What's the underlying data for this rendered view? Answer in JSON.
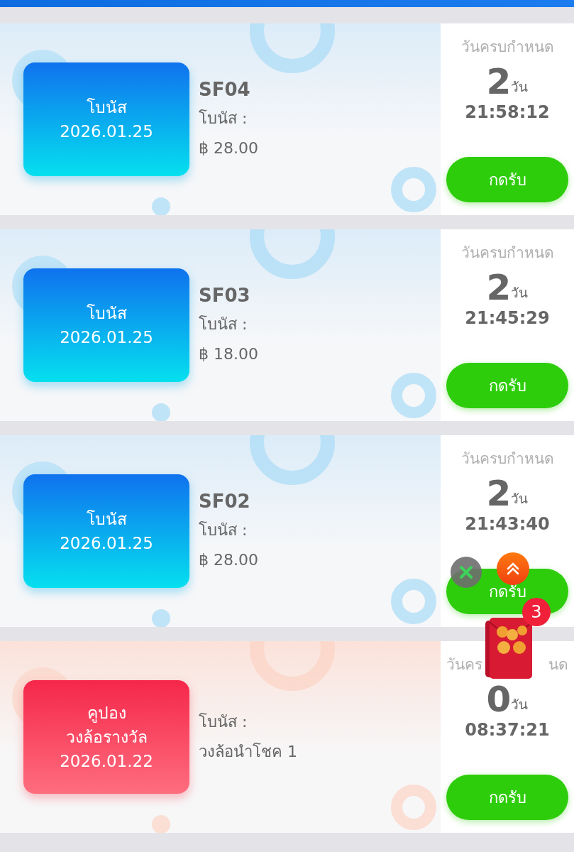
{
  "cards": [
    {
      "kind": "bonus",
      "badge_lines": [
        "โบนัส",
        "2026.01.25"
      ],
      "code": "SF04",
      "label": "โบนัส :",
      "value": "฿ 28.00",
      "due_label": "วันครบกำหนด",
      "days": "2",
      "days_unit": "วัน",
      "time": "21:58:12",
      "button": "กดรับ"
    },
    {
      "kind": "bonus",
      "badge_lines": [
        "โบนัส",
        "2026.01.25"
      ],
      "code": "SF03",
      "label": "โบนัส :",
      "value": "฿ 18.00",
      "due_label": "วันครบกำหนด",
      "days": "2",
      "days_unit": "วัน",
      "time": "21:45:29",
      "button": "กดรับ"
    },
    {
      "kind": "bonus",
      "badge_lines": [
        "โบนัส",
        "2026.01.25"
      ],
      "code": "SF02",
      "label": "โบนัส :",
      "value": "฿ 28.00",
      "due_label": "วันครบกำหนด",
      "days": "2",
      "days_unit": "วัน",
      "time": "21:43:40",
      "button": "กดรับ"
    },
    {
      "kind": "coupon",
      "badge_lines": [
        "คูปอง",
        "วงล้อรางวัล",
        "2026.01.22"
      ],
      "label": "โบนัส :",
      "value": "วงล้อนำโชค 1",
      "due_label_parts": [
        "วันคร",
        "นด"
      ],
      "days": "0",
      "days_unit": "วัน",
      "time": "08:37:21",
      "button": "กดรับ"
    }
  ],
  "floating_widget": {
    "badge_count": "3"
  }
}
